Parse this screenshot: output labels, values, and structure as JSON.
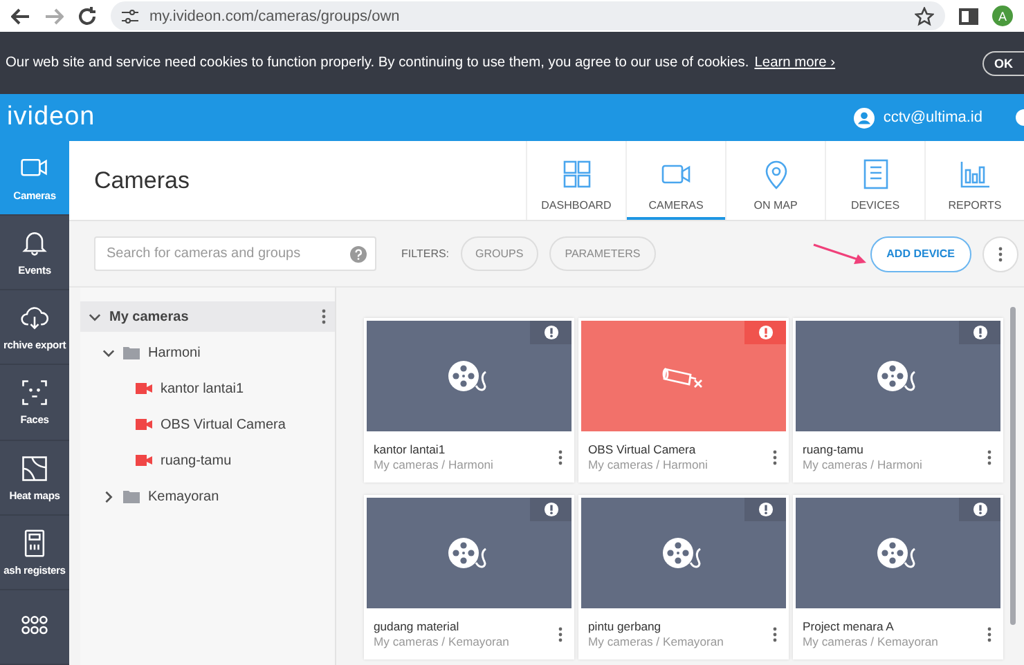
{
  "browser": {
    "url": "my.ivideon.com/cameras/groups/own",
    "profile_initial": "A"
  },
  "cookie_banner": {
    "text": "Our web site and service need cookies to function properly. By continuing to use them, you agree to our use of cookies.",
    "link": "Learn more ›",
    "button": "OK"
  },
  "header": {
    "logo": "ivideon",
    "user": "cctv@ultima.id"
  },
  "sidebar": {
    "items": [
      {
        "label": "Cameras",
        "selected": true
      },
      {
        "label": "Events",
        "selected": false
      },
      {
        "label": "rchive export",
        "selected": false
      },
      {
        "label": "Faces",
        "selected": false
      },
      {
        "label": "Heat maps",
        "selected": false
      },
      {
        "label": "ash registers",
        "selected": false
      }
    ]
  },
  "page": {
    "title": "Cameras"
  },
  "tabs": [
    {
      "label": "DASHBOARD",
      "selected": false
    },
    {
      "label": "CAMERAS",
      "selected": true
    },
    {
      "label": "ON MAP",
      "selected": false
    },
    {
      "label": "DEVICES",
      "selected": false
    },
    {
      "label": "REPORTS",
      "selected": false
    }
  ],
  "toolbar": {
    "search": {
      "placeholder": "Search for cameras and groups"
    },
    "filters_label": "FILTERS:",
    "filters": [
      "GROUPS",
      "PARAMETERS"
    ],
    "add_button": "ADD DEVICE"
  },
  "tree": [
    {
      "kind": "root",
      "label": "My cameras",
      "selected": true,
      "expanded": true,
      "children": [
        {
          "kind": "folder",
          "label": "Harmoni",
          "selected": false,
          "expanded": true,
          "children": [
            {
              "kind": "camera",
              "label": "kantor lantai1",
              "selected": false
            },
            {
              "kind": "camera",
              "label": "OBS Virtual Camera",
              "selected": false
            },
            {
              "kind": "camera",
              "label": "ruang-tamu",
              "selected": false
            }
          ]
        },
        {
          "kind": "folder",
          "label": "Kemayoran",
          "selected": false,
          "expanded": false
        }
      ]
    }
  ],
  "cards": [
    {
      "kind": "offline",
      "name": "kantor lantai1",
      "path": "My cameras / Harmoni"
    },
    {
      "kind": "error",
      "name": "OBS Virtual Camera",
      "path": "My cameras / Harmoni"
    },
    {
      "kind": "offline",
      "name": "ruang-tamu",
      "path": "My cameras / Harmoni"
    },
    {
      "kind": "offline",
      "name": "gudang material",
      "path": "My cameras / Kemayoran"
    },
    {
      "kind": "offline",
      "name": "pintu gerbang",
      "path": "My cameras / Kemayoran"
    },
    {
      "kind": "offline",
      "name": "Project menara A",
      "path": "My cameras / Kemayoran"
    }
  ]
}
